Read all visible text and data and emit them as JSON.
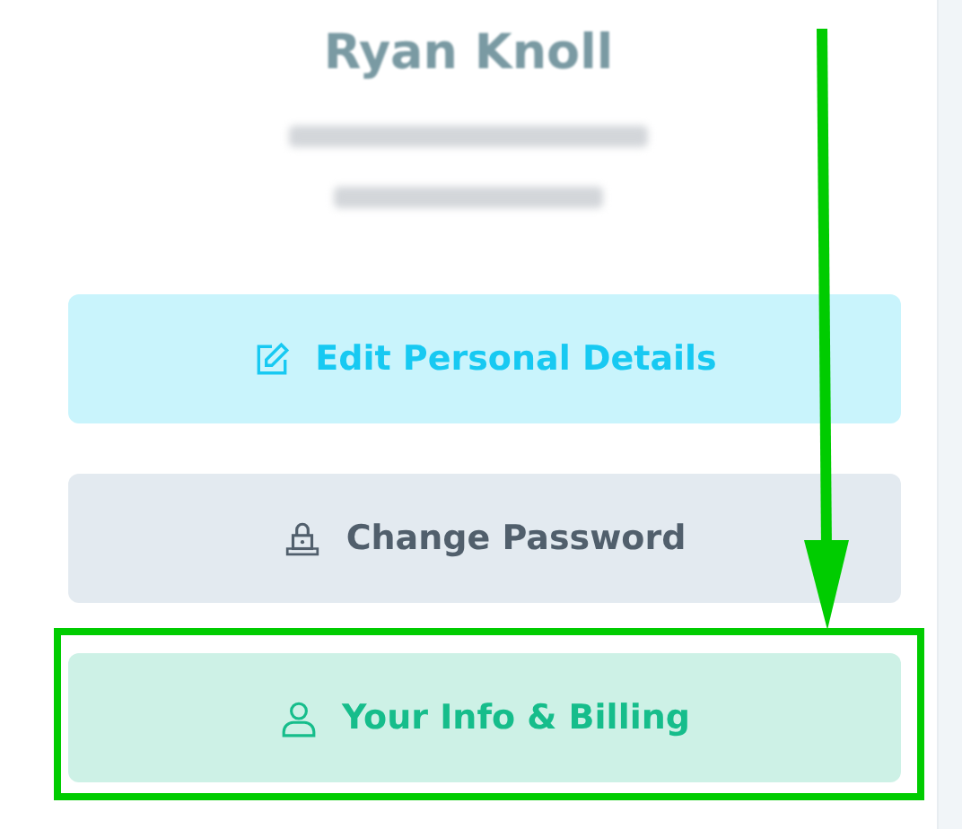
{
  "profile": {
    "name": "Ryan Knoll",
    "contact_lines": [
      {
        "kind": "redacted"
      },
      {
        "kind": "redacted"
      }
    ]
  },
  "buttons": [
    {
      "label": "Edit Personal Details",
      "kind": "edit",
      "highlighted": false
    },
    {
      "label": "Change Password",
      "kind": "password",
      "highlighted": false
    },
    {
      "label": "Your Info & Billing",
      "kind": "info",
      "highlighted": true
    }
  ],
  "annotation": {
    "arrow": true
  }
}
